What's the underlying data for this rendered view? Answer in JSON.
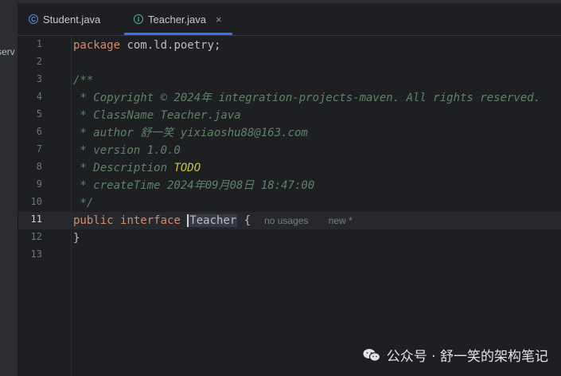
{
  "side_panel": {
    "clipped_text": "serv"
  },
  "tabs": [
    {
      "label": "Student.java",
      "icon": "class-icon",
      "active": false
    },
    {
      "label": "Teacher.java",
      "icon": "interface-icon",
      "active": true,
      "close": "×"
    }
  ],
  "gutter": {
    "current_line": 11,
    "line_numbers": [
      "1",
      "2",
      "3",
      "4",
      "5",
      "6",
      "7",
      "8",
      "9",
      "10",
      "11",
      "12",
      "13"
    ]
  },
  "code": {
    "l1_kw": "package",
    "l1_rest": " com.ld.poetry;",
    "l3": "/**",
    "l4": " * Copyright © 2024年 integration-projects-maven. All rights reserved.",
    "l5": " * ClassName Teacher.java",
    "l6": " * author 舒一笑 yixiaoshu88@163.com",
    "l7": " * version 1.0.0",
    "l8_pre": " * Description ",
    "l8_todo": "TODO",
    "l9": " * createTime 2024年09月08日 18:47:00",
    "l10": " */",
    "l11_kw1": "public",
    "l11_kw2": "interface",
    "l11_name": "Teacher",
    "l11_brace": "{",
    "l11_hint_usages": "no usages",
    "l11_hint_new": "new *",
    "l12": "}"
  },
  "watermark": {
    "text": "公众号 · 舒一笑的架构笔记",
    "icon": "wechat-icon"
  },
  "colors": {
    "accent": "#3574f0",
    "keyword": "#cf8e6d",
    "comment": "#5f826b",
    "todo": "#c7c44a",
    "background": "#1e1f22"
  }
}
